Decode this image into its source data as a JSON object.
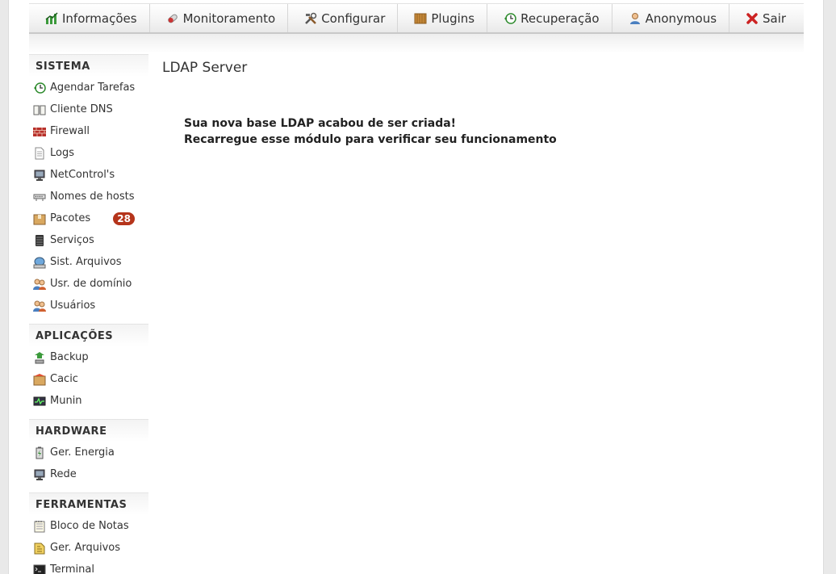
{
  "nav": {
    "items": [
      {
        "label": "Informações",
        "icon": "chart-icon"
      },
      {
        "label": "Monitoramento",
        "icon": "pill-icon"
      },
      {
        "label": "Configurar",
        "icon": "tools-icon"
      },
      {
        "label": "Plugins",
        "icon": "plugin-icon"
      },
      {
        "label": "Recuperação",
        "icon": "restore-icon"
      },
      {
        "label": "Anonymous",
        "icon": "user-icon"
      },
      {
        "label": "Sair",
        "icon": "close-icon"
      }
    ]
  },
  "sidebar": {
    "sections": [
      {
        "title": "SISTEMA",
        "items": [
          {
            "label": "Agendar Tarefas",
            "icon": "clock-icon"
          },
          {
            "label": "Cliente DNS",
            "icon": "book-icon"
          },
          {
            "label": "Firewall",
            "icon": "firewall-icon"
          },
          {
            "label": "Logs",
            "icon": "document-icon"
          },
          {
            "label": "NetControl's",
            "icon": "monitor-icon"
          },
          {
            "label": "Nomes de hosts",
            "icon": "network-icon"
          },
          {
            "label": "Pacotes",
            "icon": "package-icon",
            "badge": "28"
          },
          {
            "label": "Serviços",
            "icon": "server-icon"
          },
          {
            "label": "Sist. Arquivos",
            "icon": "disk-icon"
          },
          {
            "label": "Usr. de domínio",
            "icon": "users-icon"
          },
          {
            "label": "Usuários",
            "icon": "users-icon"
          }
        ]
      },
      {
        "title": "APLICAÇÕES",
        "items": [
          {
            "label": "Backup",
            "icon": "backup-icon"
          },
          {
            "label": "Cacic",
            "icon": "cacic-icon"
          },
          {
            "label": "Munin",
            "icon": "graph-monitor-icon"
          }
        ]
      },
      {
        "title": "HARDWARE",
        "items": [
          {
            "label": "Ger. Energia",
            "icon": "battery-icon"
          },
          {
            "label": "Rede",
            "icon": "monitor-icon"
          }
        ]
      },
      {
        "title": "FERRAMENTAS",
        "items": [
          {
            "label": "Bloco de Notas",
            "icon": "notepad-icon"
          },
          {
            "label": "Ger. Arquivos",
            "icon": "file-manager-icon"
          },
          {
            "label": "Terminal",
            "icon": "terminal-icon"
          }
        ]
      }
    ]
  },
  "content": {
    "title": "LDAP Server",
    "message_line1": "Sua nova base LDAP acabou de ser criada!",
    "message_line2": "Recarregue esse módulo para verificar seu funcionamento"
  },
  "colors": {
    "badge": "#b5341b",
    "exit_icon": "#cc2222"
  }
}
